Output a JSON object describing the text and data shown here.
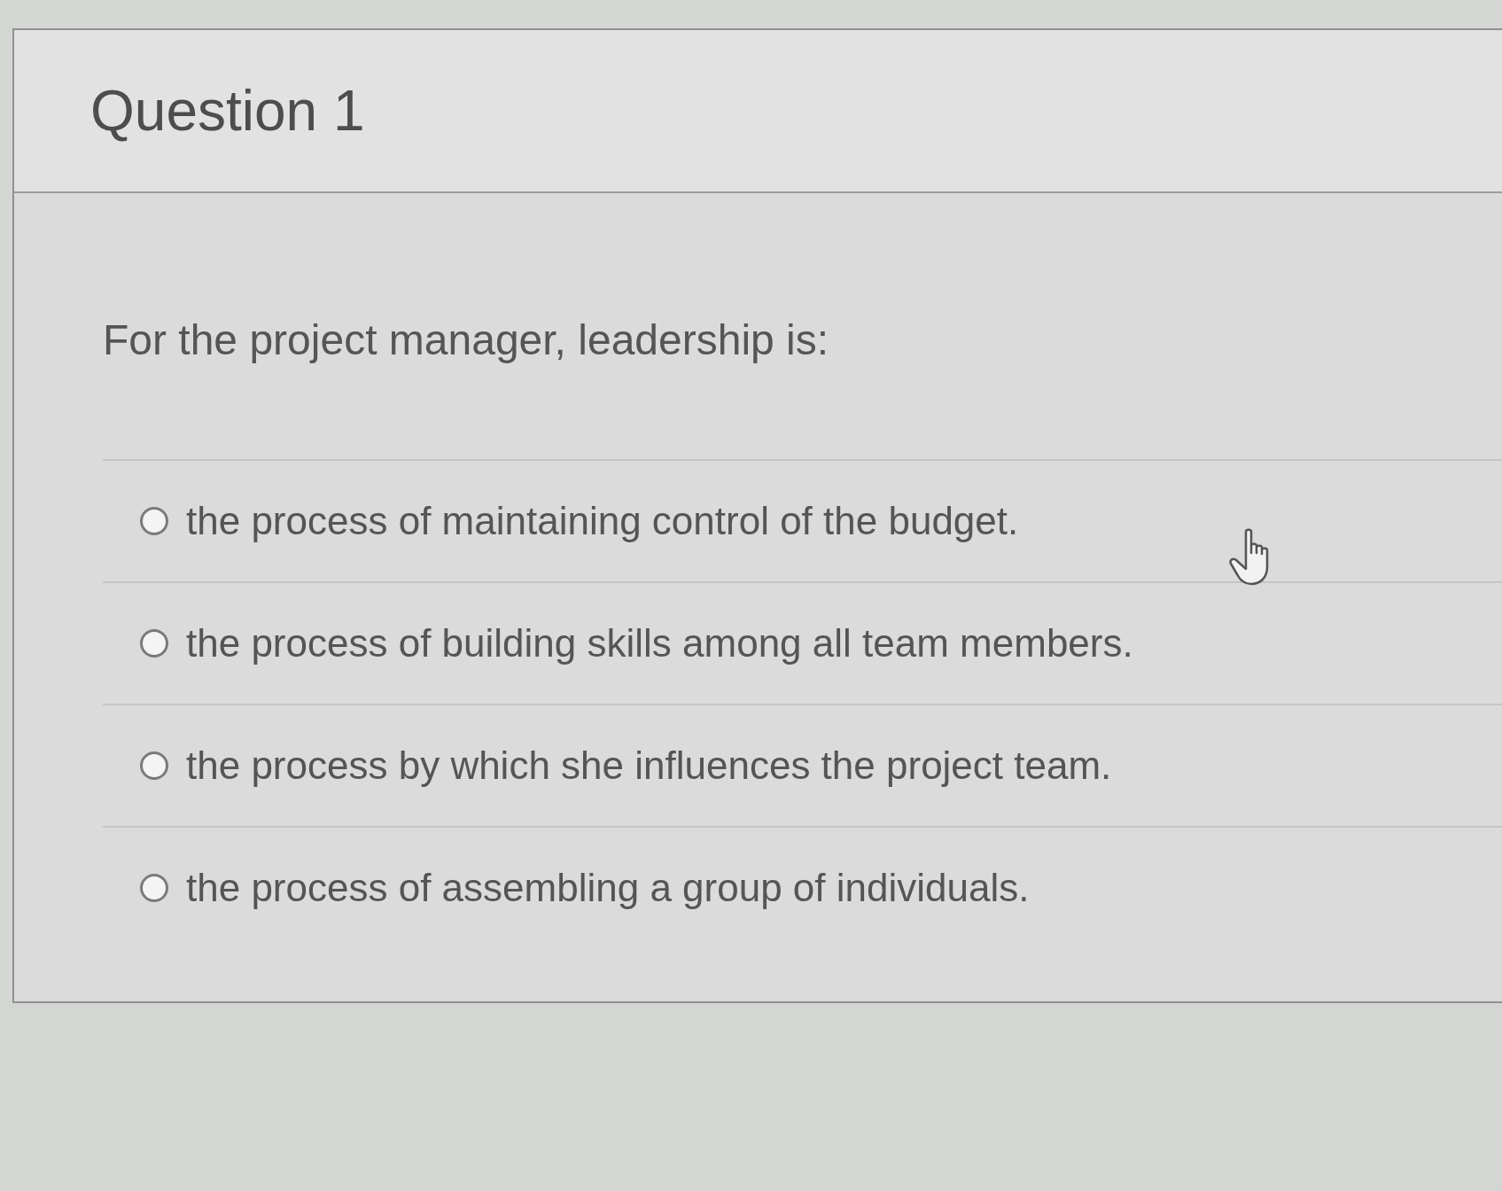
{
  "question": {
    "title": "Question 1",
    "prompt": "For the project manager, leadership is:",
    "options": [
      {
        "label": "the process of maintaining control of the budget.",
        "selected": false
      },
      {
        "label": "the process of building skills among all team members.",
        "selected": false
      },
      {
        "label": "the process by which she influences the project team.",
        "selected": false
      },
      {
        "label": "the process of assembling a group of individuals.",
        "selected": false
      }
    ]
  }
}
